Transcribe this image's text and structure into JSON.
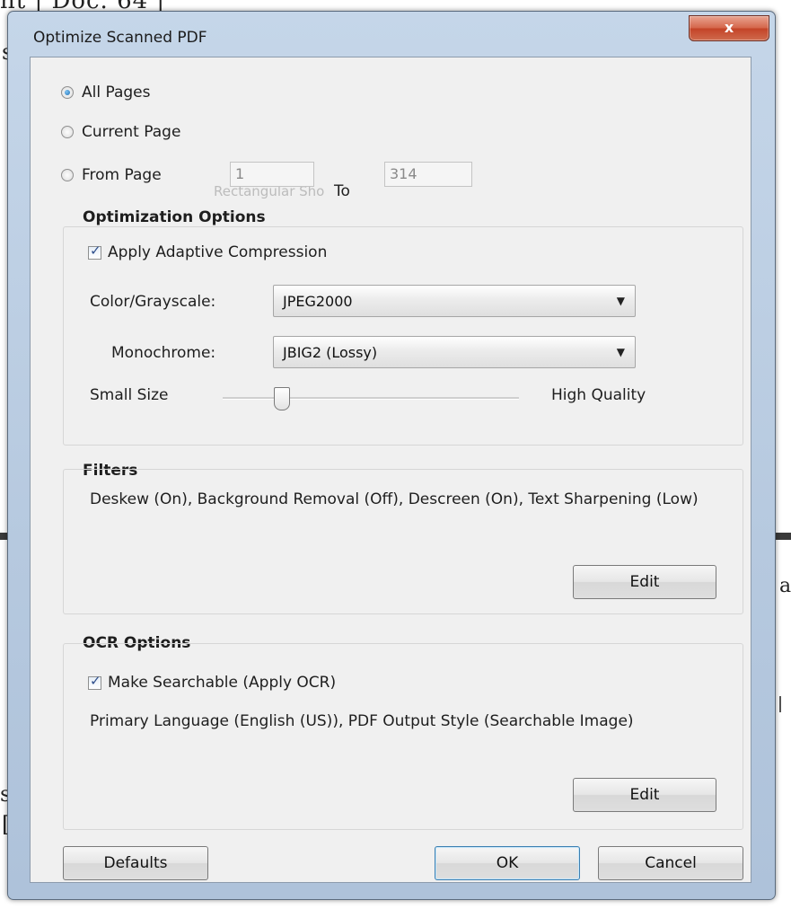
{
  "window": {
    "title": "Optimize Scanned PDF",
    "close_glyph": "x"
  },
  "background_doc": {
    "top_fragment": "nt | Doc. 64 |",
    "left_fragment_1": "s",
    "left_fragment_2": "st",
    "left_fragment_3": "[",
    "right_fragment": "a"
  },
  "page_range": {
    "all_pages_label": "All Pages",
    "current_page_label": "Current Page",
    "from_page_label": "From Page",
    "from_value": "1",
    "to_label": "To",
    "to_value": "314",
    "ghost_text": "Rectangular Sho",
    "selected": "all_pages"
  },
  "optimization": {
    "title": "Optimization Options",
    "adaptive_label": "Apply Adaptive Compression",
    "adaptive_checked": true,
    "color_label": "Color/Grayscale:",
    "color_value": "JPEG2000",
    "mono_label": "Monochrome:",
    "mono_value": "JBIG2 (Lossy)",
    "small_label": "Small Size",
    "high_label": "High Quality",
    "quality_level": 0.2
  },
  "filters": {
    "title": "Filters",
    "description": "Deskew (On), Background Removal (Off), Descreen (On), Text Sharpening (Low)",
    "edit_label": "Edit"
  },
  "ocr": {
    "title": "OCR Options",
    "searchable_label": "Make Searchable (Apply OCR)",
    "searchable_checked": true,
    "description": "Primary Language (English (US)), PDF Output Style (Searchable Image)",
    "edit_label": "Edit"
  },
  "footer": {
    "defaults_label": "Defaults",
    "ok_label": "OK",
    "cancel_label": "Cancel"
  },
  "colors": {
    "title_bar": "#b6c9df",
    "close_button": "#c44428",
    "dialog_bg": "#f0f0f0",
    "default_button_border": "#3c7fb1"
  }
}
